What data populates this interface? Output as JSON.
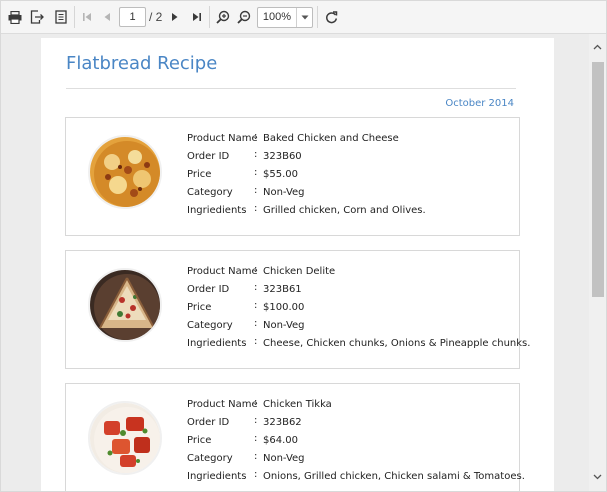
{
  "toolbar": {
    "current_page": "1",
    "page_total": "/ 2",
    "zoom": "100%"
  },
  "document": {
    "title": "Flatbread Recipe",
    "date": "October 2014",
    "labels": {
      "product_name": "Product Name",
      "order_id": "Order ID",
      "price": "Price",
      "category": "Category",
      "ingredients": "Ingriedients"
    },
    "colon": ":",
    "items": [
      {
        "product_name": "Baked Chicken and Cheese",
        "order_id": "323B60",
        "price": "$55.00",
        "category": "Non-Veg",
        "ingredients": "Grilled chicken, Corn and Olives."
      },
      {
        "product_name": "Chicken Delite",
        "order_id": "323B61",
        "price": "$100.00",
        "category": "Non-Veg",
        "ingredients": "Cheese, Chicken chunks, Onions & Pineapple chunks."
      },
      {
        "product_name": "Chicken Tikka",
        "order_id": "323B62",
        "price": "$64.00",
        "category": "Non-Veg",
        "ingredients": "Onions, Grilled chicken, Chicken salami & Tomatoes."
      }
    ]
  },
  "colors": {
    "title": "#4a86c5",
    "toolbar_bg": "#f5f5f5",
    "doc_bg": "#ececec"
  },
  "icons": [
    "print-icon",
    "export-icon",
    "page-setup-icon",
    "first-page-icon",
    "previous-page-icon",
    "next-page-icon",
    "last-page-icon",
    "zoom-in-icon",
    "zoom-out-icon",
    "refresh-icon"
  ]
}
